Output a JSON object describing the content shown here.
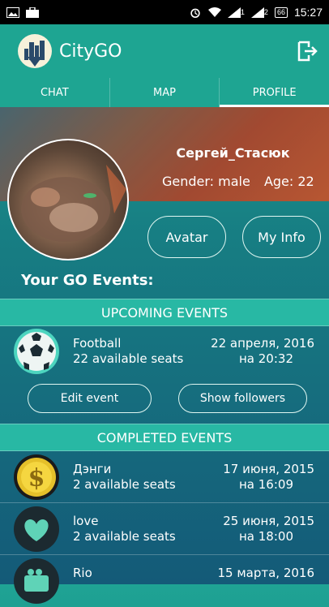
{
  "status_bar": {
    "time": "15:27",
    "battery": "66",
    "sim1": "1",
    "sim2": "2"
  },
  "app": {
    "title": "CityGO"
  },
  "tabs": [
    {
      "label": "CHAT",
      "active": false
    },
    {
      "label": "MAP",
      "active": false
    },
    {
      "label": "PROFILE",
      "active": true
    }
  ],
  "profile": {
    "name": "Сергей_Стасюк",
    "gender": "Gender: male",
    "age": "Age: 22",
    "avatar_button": "Avatar",
    "info_button": "My Info"
  },
  "events_heading": "Your GO Events:",
  "upcoming": {
    "title": "UPCOMING EVENTS",
    "items": [
      {
        "name": "Football",
        "seats": "22 available seats",
        "date": "22 апреля, 2016",
        "time": "на 20:32",
        "icon": "soccer-ball-icon"
      }
    ],
    "edit_button": "Edit event",
    "followers_button": "Show followers"
  },
  "completed": {
    "title": "COMPLETED EVENTS",
    "items": [
      {
        "name": "Дэнги",
        "seats": "2 available seats",
        "date": "17 июня, 2015",
        "time": "на 16:09",
        "icon": "dollar-coin-icon"
      },
      {
        "name": "love",
        "seats": "2 available seats",
        "date": "25 июня, 2015",
        "time": "на 18:00",
        "icon": "heart-icon"
      },
      {
        "name": "Rio",
        "seats": "",
        "date": "15 марта, 2016",
        "time": "",
        "icon": "camera-icon"
      }
    ]
  }
}
